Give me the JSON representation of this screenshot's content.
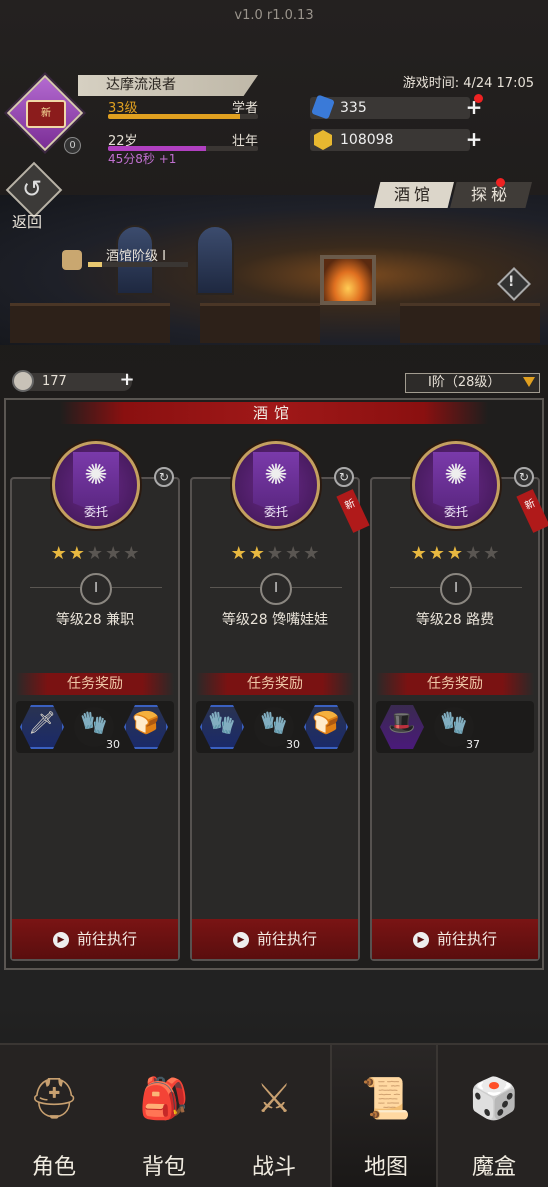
{
  "version": "v1.0 r1.0.13",
  "game_time": "游戏时间: 4/24 17:05",
  "player": {
    "name": "达摩流浪者",
    "level": "33级",
    "level_title": "学者",
    "level_progress": 0.88,
    "age": "22岁",
    "age_title": "壮年",
    "age_progress": 0.65,
    "age_timer": "45分8秒 +1",
    "avatar_new": "新",
    "avatar_badge": "0"
  },
  "resources": {
    "gems": "335",
    "gold": "108098"
  },
  "back_label": "返回",
  "tabs": {
    "tavern": "酒馆",
    "explore": "探秘"
  },
  "tavern_rank_label": "酒馆阶级 Ⅰ",
  "tavern_rank_progress": 0.14,
  "tickets": "177",
  "level_select": "Ⅰ阶（28级）",
  "panel_title": "酒馆",
  "emblem_label": "委托",
  "new_tag": "新",
  "grade_label": "Ⅰ",
  "reward_header": "任务奖励",
  "go_label": "前往执行",
  "quests": [
    {
      "title": "等级28 兼职",
      "stars": 2,
      "is_new": false,
      "rewards": [
        {
          "icon": "sword-icon",
          "glyph": "🗡",
          "count": "",
          "frame": "blue"
        },
        {
          "icon": "glove-icon",
          "glyph": "🧤",
          "count": "30",
          "frame": "round"
        },
        {
          "icon": "bread-icon",
          "glyph": "🍞",
          "count": "",
          "frame": "blue"
        }
      ]
    },
    {
      "title": "等级28 馋嘴娃娃",
      "stars": 2,
      "is_new": true,
      "rewards": [
        {
          "icon": "gauntlet-icon",
          "glyph": "🧤",
          "count": "",
          "frame": "blue"
        },
        {
          "icon": "glove-icon",
          "glyph": "🧤",
          "count": "30",
          "frame": "round"
        },
        {
          "icon": "bread-icon",
          "glyph": "🍞",
          "count": "",
          "frame": "blue"
        }
      ]
    },
    {
      "title": "等级28 路费",
      "stars": 3,
      "is_new": true,
      "rewards": [
        {
          "icon": "hat-icon",
          "glyph": "🎩",
          "count": "",
          "frame": "purple"
        },
        {
          "icon": "glove-icon",
          "glyph": "🧤",
          "count": "37",
          "frame": "round"
        }
      ]
    }
  ],
  "nav": [
    {
      "label": "角色",
      "icon": "helmet-icon",
      "glyph": "⛑"
    },
    {
      "label": "背包",
      "icon": "backpack-icon",
      "glyph": "🎒"
    },
    {
      "label": "战斗",
      "icon": "sword-shield-icon",
      "glyph": "⚔"
    },
    {
      "label": "地图",
      "icon": "scroll-map-icon",
      "glyph": "📜"
    },
    {
      "label": "魔盒",
      "icon": "magic-box-icon",
      "glyph": "🎲"
    }
  ],
  "nav_active": 3,
  "colors": {
    "gem": "#3a7ad8",
    "gold": "#e8b830",
    "accent_red": "#8a1010",
    "exp_bar": "#e0a020",
    "age_bar": "#b040c0"
  }
}
